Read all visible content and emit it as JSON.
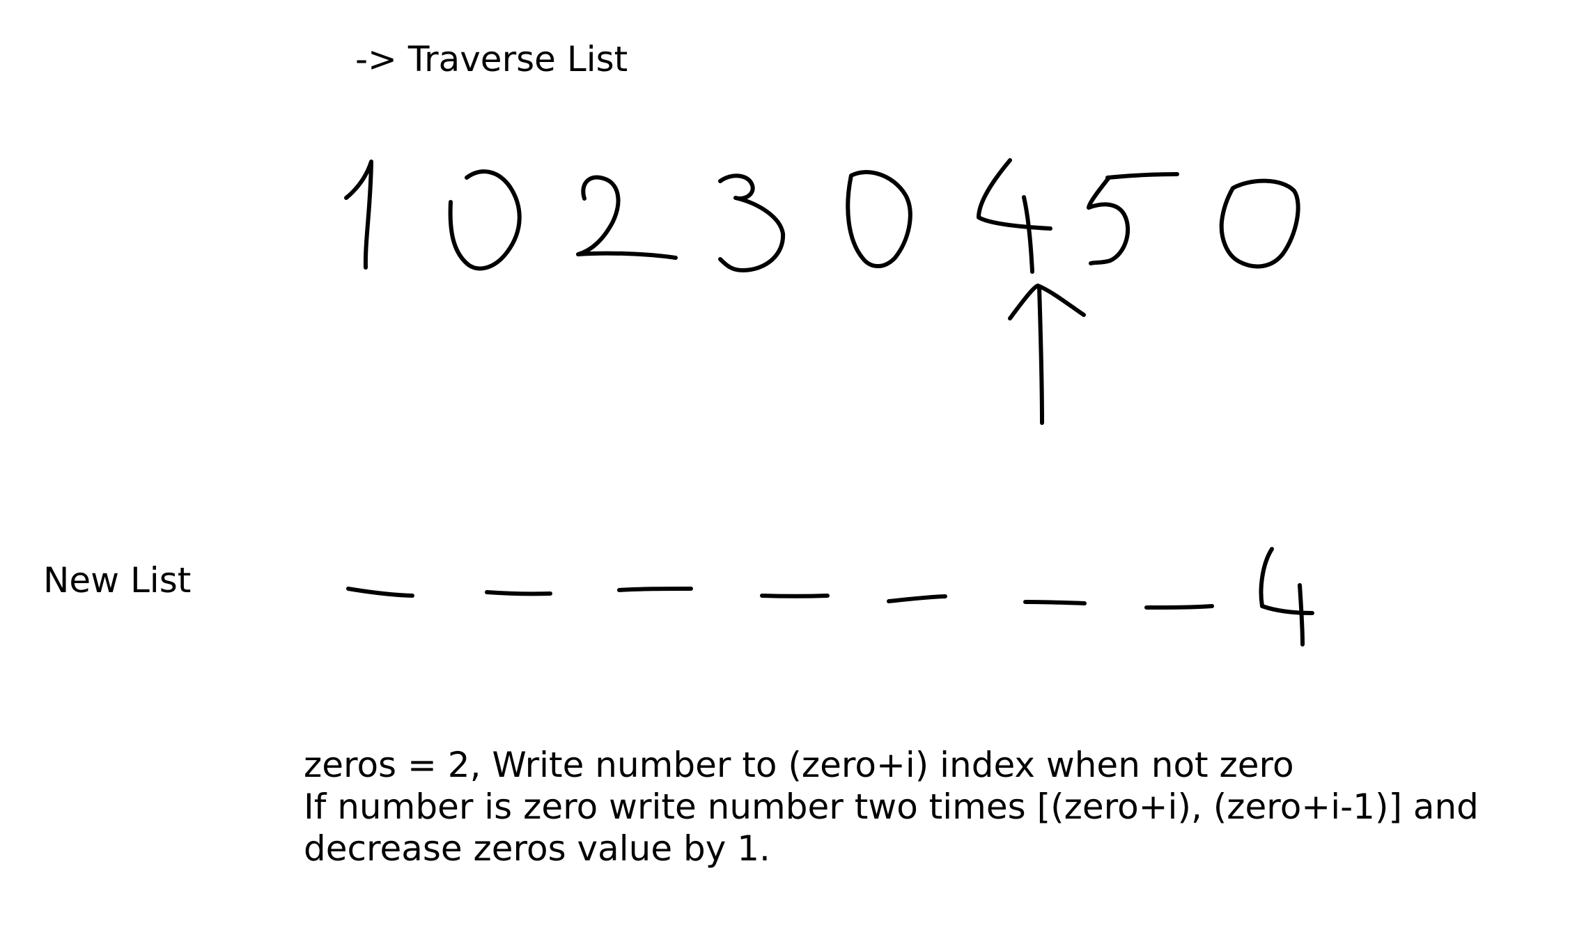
{
  "title": "-> Traverse List",
  "traverse_list": {
    "values": [
      1,
      0,
      2,
      3,
      0,
      4,
      5,
      0
    ],
    "pointer_index": 5
  },
  "new_list": {
    "label": "New List",
    "slots": [
      "",
      "",
      "",
      "",
      "",
      "",
      "",
      "4"
    ]
  },
  "note": {
    "line1": "zeros = 2,  Write number to (zero+i) index when not zero",
    "line2": "If number is zero write number two times [(zero+i), (zero+i-1)] and",
    "line3": "decrease zeros value by 1."
  }
}
